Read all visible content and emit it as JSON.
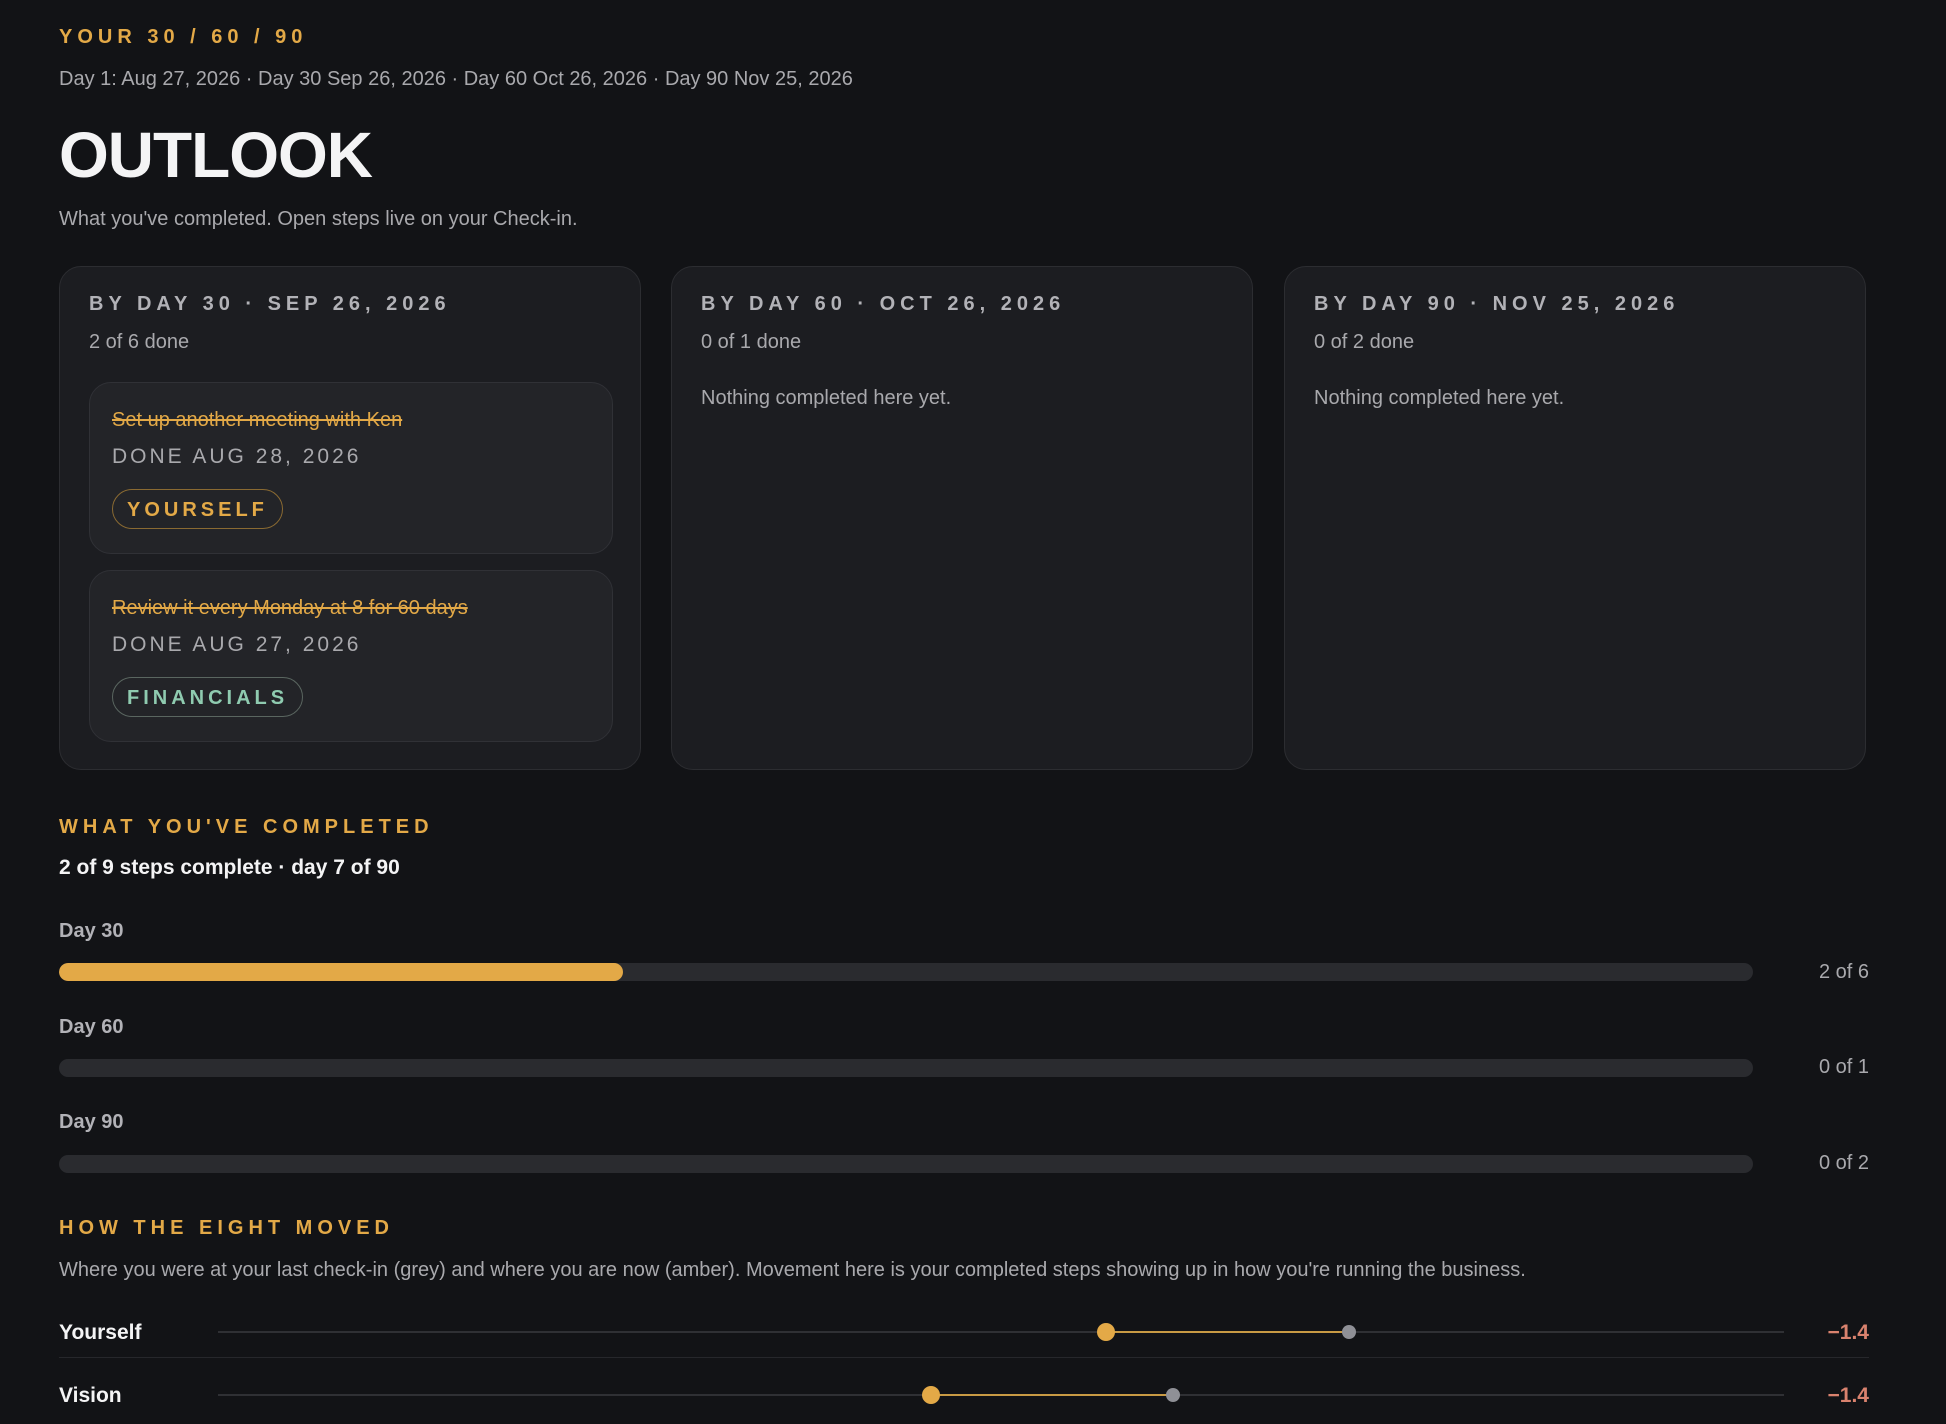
{
  "header": {
    "eyebrow": "YOUR 30 / 60 / 90",
    "dates": "Day 1: Aug 27, 2026 · Day 30 Sep 26, 2026 · Day 60 Oct 26, 2026 · Day 90 Nov 25, 2026",
    "title": "OUTLOOK",
    "subtitle": "What you've completed. Open steps live on your Check-in."
  },
  "columns": [
    {
      "heading": "BY DAY 30 · SEP 26, 2026",
      "count": "2 of 6 done",
      "items": [
        {
          "text": "Set up another meeting with Ken",
          "date": "DONE AUG 28, 2026",
          "tag": "YOURSELF"
        },
        {
          "text": "Review it every Monday at 8 for 60 days",
          "date": "DONE AUG 27, 2026",
          "tag": "FINANCIALS"
        }
      ]
    },
    {
      "heading": "BY DAY 60 · OCT 26, 2026",
      "count": "0 of 1 done",
      "empty": "Nothing completed here yet."
    },
    {
      "heading": "BY DAY 90 · NOV 25, 2026",
      "count": "0 of 2 done",
      "empty": "Nothing completed here yet."
    }
  ],
  "completed": {
    "label": "WHAT YOU'VE COMPLETED",
    "summary": "2 of 9 steps complete · day 7 of 90",
    "bars": [
      {
        "label": "Day 30",
        "count": "2 of 6",
        "fraction": 0.333
      },
      {
        "label": "Day 60",
        "count": "0 of 1",
        "fraction": 0
      },
      {
        "label": "Day 90",
        "count": "0 of 2",
        "fraction": 0
      }
    ]
  },
  "eight": {
    "label": "HOW THE EIGHT MOVED",
    "description": "Where you were at your last check-in (grey) and where you are now (amber). Movement here is your completed steps showing up in how you're running the business.",
    "rows": [
      {
        "name": "Yourself",
        "now": 0.567,
        "previous": 0.722,
        "delta": "−1.4"
      },
      {
        "name": "Vision",
        "now": 0.455,
        "previous": 0.61,
        "delta": "−1.4"
      }
    ]
  },
  "colors": {
    "accent": "#e3a947",
    "background": "#121316",
    "card": "#1c1d21",
    "financials": "#8fcbb0",
    "negative": "#d9826e"
  }
}
